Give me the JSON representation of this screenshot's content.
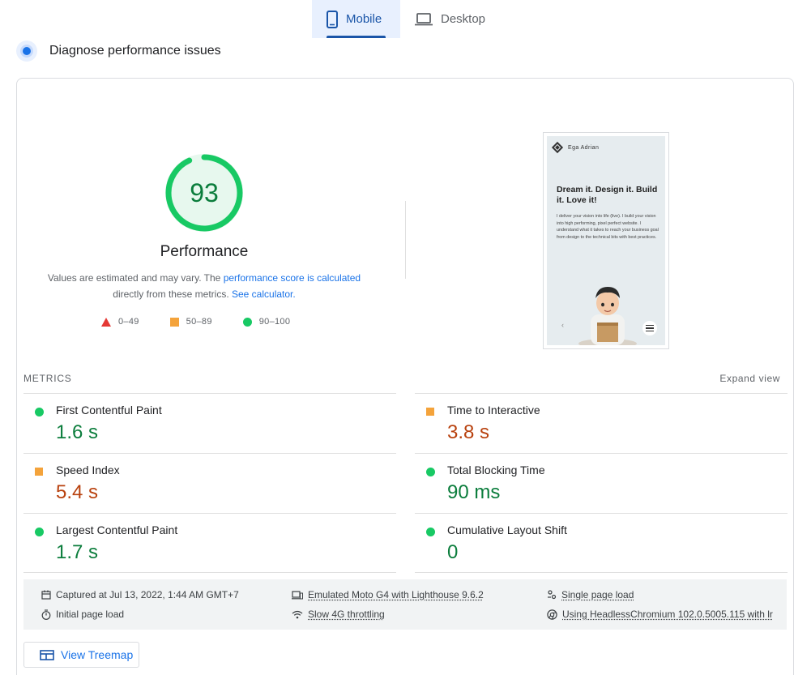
{
  "tabs": [
    {
      "label": "Mobile",
      "active": true,
      "icon": "phone-icon"
    },
    {
      "label": "Desktop",
      "active": false,
      "icon": "laptop-icon"
    }
  ],
  "diagnose": {
    "title": "Diagnose performance issues"
  },
  "score": {
    "value": 93,
    "fraction": 0.93,
    "label": "Performance",
    "color": "#18c964",
    "desc_prefix": "Values are estimated and may vary. The",
    "desc_link1": "performance score is calculated",
    "desc_mid": "directly from these metrics.",
    "desc_link2": "See calculator."
  },
  "legend": [
    {
      "shape": "triangle",
      "range": "0–49",
      "color": "#e53935"
    },
    {
      "shape": "square",
      "range": "50–89",
      "color": "#f4a33b"
    },
    {
      "shape": "circle",
      "range": "90–100",
      "color": "#18c964"
    }
  ],
  "thumbnail": {
    "brand": "Ega Adrian",
    "heading": "Dream it. Design it. Build it. Love it!",
    "body": "I deliver your vision into life (live). I build your vision into high performing, pixel perfect website. I understand what it takes to reach your business goal from design to the technical bits with best practices."
  },
  "metrics": {
    "section_label": "METRICS",
    "expand_label": "Expand view",
    "items": [
      {
        "name": "First Contentful Paint",
        "value": "1.6 s",
        "rating": "good"
      },
      {
        "name": "Time to Interactive",
        "value": "3.8 s",
        "rating": "average"
      },
      {
        "name": "Speed Index",
        "value": "5.4 s",
        "rating": "average"
      },
      {
        "name": "Total Blocking Time",
        "value": "90 ms",
        "rating": "good"
      },
      {
        "name": "Largest Contentful Paint",
        "value": "1.7 s",
        "rating": "good"
      },
      {
        "name": "Cumulative Layout Shift",
        "value": "0",
        "rating": "good"
      }
    ]
  },
  "runtime": {
    "captured": "Captured at Jul 13, 2022, 1:44 AM GMT+7",
    "initial": "Initial page load",
    "device": "Emulated Moto G4 with Lighthouse 9.6.2",
    "throttling": "Slow 4G throttling",
    "single": "Single page load",
    "browser": "Using HeadlessChromium 102.0.5005.115 with lr"
  },
  "treemap": {
    "label": "View Treemap"
  }
}
